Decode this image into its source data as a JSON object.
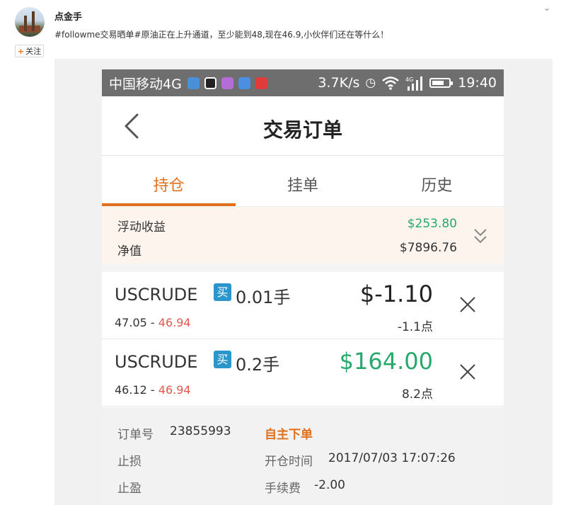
{
  "post": {
    "author": "点金手",
    "text": "#followme交易晒单#原油正在上升通道，至少能到48,现在46.9,小伙伴们还在等什么！",
    "follow_label": "关注",
    "follow_plus": "+",
    "menu_chevron": "⌄"
  },
  "statusbar": {
    "carrier": "中国移动4G",
    "speed": "3.7K/s",
    "time": "19:40",
    "app_icons": [
      "browser-icon",
      "qq-icon",
      "gallery-icon",
      "cloud-icon",
      "huawei-icon"
    ],
    "status_icons": [
      "alarm-icon",
      "wifi-icon",
      "signal-icon",
      "battery-icon"
    ],
    "network_label": "4G"
  },
  "screen": {
    "title": "交易订单",
    "tabs": [
      {
        "label": "持仓",
        "active": true
      },
      {
        "label": "挂单",
        "active": false
      },
      {
        "label": "历史",
        "active": false
      }
    ],
    "summary": {
      "floating_label": "浮动收益",
      "floating_value": "$253.80",
      "equity_label": "净值",
      "equity_value": "$7896.76"
    },
    "orders": [
      {
        "symbol": "USCRUDE",
        "side": "买",
        "lots": "0.01手",
        "open": "47.05",
        "sep": " - ",
        "current": "46.94",
        "pl": "$-1.10",
        "points": "-1.1点",
        "pl_sign": "neg"
      },
      {
        "symbol": "USCRUDE",
        "side": "买",
        "lots": "0.2手",
        "open": "46.12",
        "sep": " - ",
        "current": "46.94",
        "pl": "$164.00",
        "points": "8.2点",
        "pl_sign": "pos"
      }
    ],
    "details": {
      "order_no_label": "订单号",
      "order_no": "23855993",
      "type": "自主下单",
      "stop_loss_label": "止损",
      "open_time_label": "开仓时间",
      "open_time": "2017/07/03 17:07:26",
      "take_profit_label": "止盈",
      "fee_label": "手续费",
      "fee": "-2.00"
    }
  },
  "colors": {
    "accent": "#e0701b",
    "profit": "#27a96b",
    "price_red": "#e05a4e",
    "buy_badge": "#2a96cc"
  }
}
